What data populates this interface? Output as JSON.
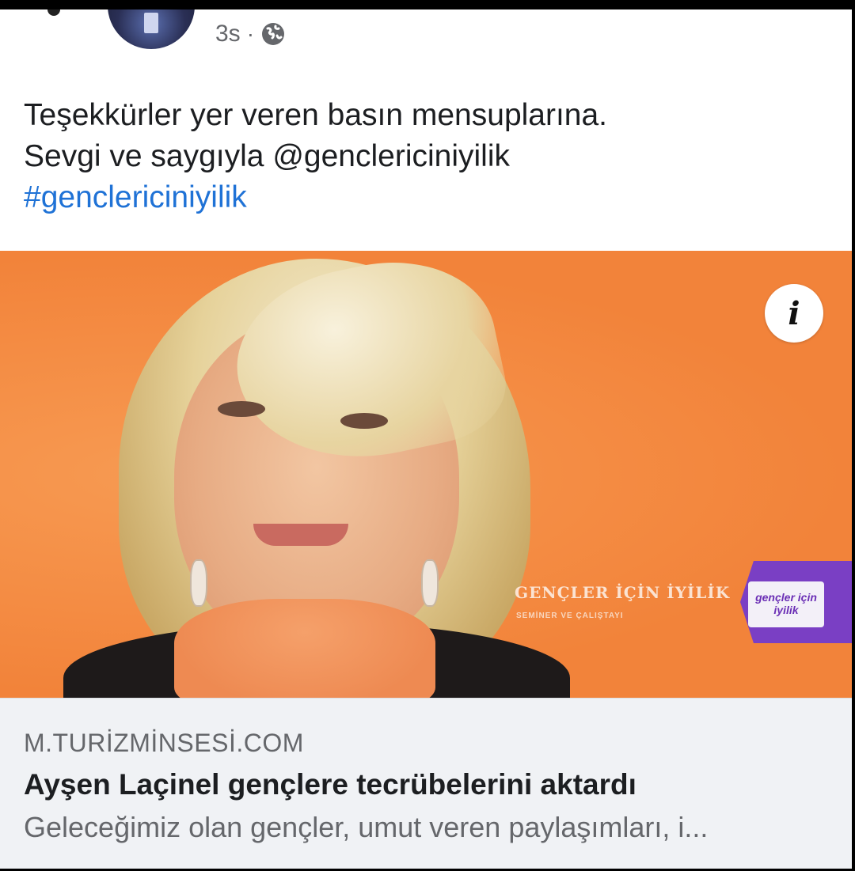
{
  "post": {
    "time": "3s",
    "separator": "·",
    "privacy_icon": "globe-icon",
    "text_lines": [
      "Teşekkürler yer veren basın mensuplarına.",
      "Sevgi ve saygıyla @genclericiniyilik"
    ],
    "hashtag": "#genclericiniyilik"
  },
  "image": {
    "brand_title": "GENÇLER İÇİN İYİLİK",
    "brand_subtitle": "SEMİNER VE ÇALIŞTAYI",
    "logo_text": "gençler için iyilik",
    "info_icon": "info-icon",
    "colors": {
      "background": "#f58a3f",
      "logo": "#7a3fc4"
    }
  },
  "link_preview": {
    "domain": "M.TURİZMİNSESİ.COM",
    "title": "Ayşen Laçinel gençlere tecrübelerini aktardı",
    "description": "Geleceğimiz olan gençler, umut veren paylaşımları, i..."
  },
  "colors": {
    "hashtag": "#1f72d6",
    "text": "#1c1e21",
    "muted": "#65676b",
    "preview_bg": "#f0f2f5"
  }
}
